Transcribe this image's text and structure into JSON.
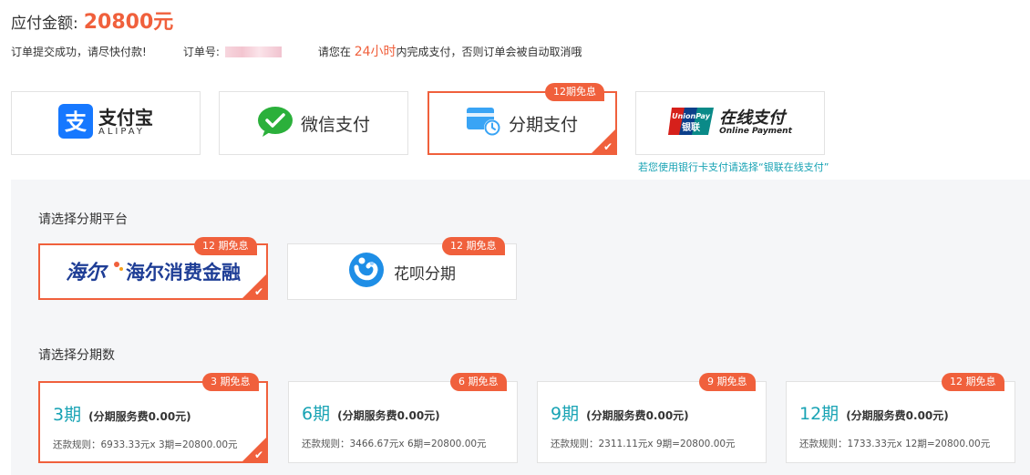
{
  "header": {
    "amount_label": "应付金额:",
    "amount_value": "20800元"
  },
  "info": {
    "submitted": "订单提交成功，请尽快付款!",
    "order_label": "订单号:",
    "deadline_prefix": "请您在",
    "deadline_hours": "24小时",
    "deadline_suffix": "内完成支付，否则订单会被自动取消哦"
  },
  "payment_methods": {
    "alipay": {
      "name": "支付宝",
      "sub": "ALIPAY"
    },
    "wechat": {
      "name": "微信支付"
    },
    "installment": {
      "name": "分期支付",
      "badge": "12期免息",
      "selected": true
    },
    "unionpay": {
      "logo_top": "UnionPay",
      "logo_bottom": "银联",
      "name": "在线支付",
      "sub": "Online Payment"
    },
    "union_note": "若您使用银行卡支付请选择“银联在线支付”"
  },
  "platforms": {
    "title": "请选择分期平台",
    "items": [
      {
        "name": "海尔消费金融",
        "badge": "12 期免息",
        "selected": true
      },
      {
        "name": "花呗分期",
        "badge": "12 期免息",
        "selected": false
      }
    ]
  },
  "terms": {
    "title": "请选择分期数",
    "items": [
      {
        "period": "3期",
        "fee": "(分期服务费0.00元)",
        "rule": "还款规则：6933.33元x 3期=20800.00元",
        "badge": "3 期免息",
        "selected": true
      },
      {
        "period": "6期",
        "fee": "(分期服务费0.00元)",
        "rule": "还款规则：3466.67元x 6期=20800.00元",
        "badge": "6 期免息",
        "selected": false
      },
      {
        "period": "9期",
        "fee": "(分期服务费0.00元)",
        "rule": "还款规则：2311.11元x 9期=20800.00元",
        "badge": "9 期免息",
        "selected": false
      },
      {
        "period": "12期",
        "fee": "(分期服务费0.00元)",
        "rule": "还款规则：1733.33元x 12期=20800.00元",
        "badge": "12 期免息",
        "selected": false
      }
    ]
  },
  "colors": {
    "accent": "#f0603c",
    "teal": "#18a3b4",
    "panel_bg": "#f5f6f8"
  }
}
